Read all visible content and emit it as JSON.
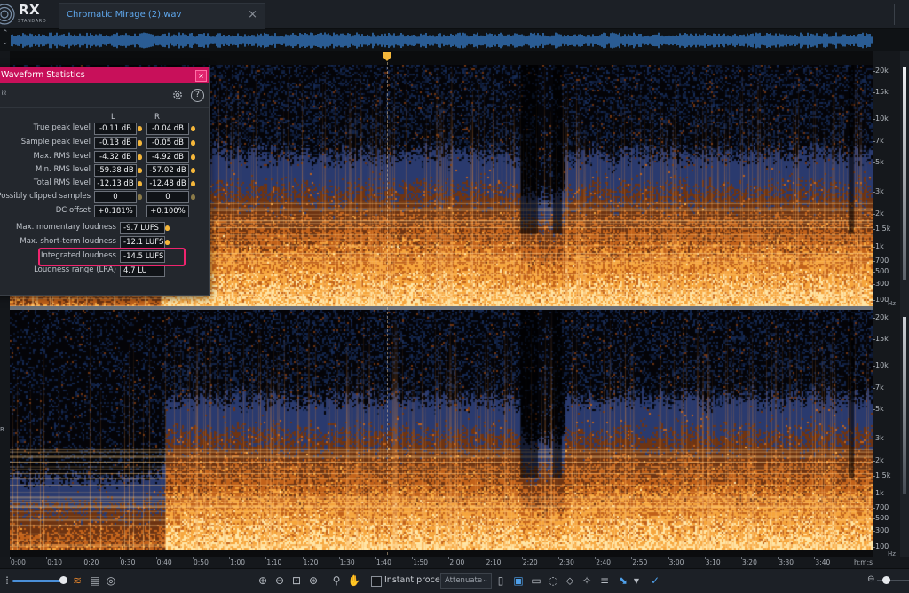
{
  "app": {
    "logo_text": "RX",
    "logo_subtext": "STANDARD",
    "tab_title": "Chromatic Mirage (2).wav",
    "tab_close": "×"
  },
  "colors": {
    "accent_pink": "#c8105a",
    "highlight_pink": "#f0246e",
    "link_blue": "#5fa8ee",
    "pin_gold": "#f4b63a",
    "spectro_hot": "#ffd27a",
    "spectro_mid": "#e07a1c",
    "spectro_cold": "#1b3f78"
  },
  "stats_panel": {
    "title": "Waveform Statistics",
    "close": "×",
    "help": "?",
    "col_left": "L",
    "col_right": "R",
    "rows": [
      {
        "label": "True peak level",
        "l": "-0.11 dB",
        "r": "-0.04 dB"
      },
      {
        "label": "Sample peak level",
        "l": "-0.13 dB",
        "r": "-0.05 dB"
      },
      {
        "label": "Max. RMS level",
        "l": "-4.32 dB",
        "r": "-4.92 dB"
      },
      {
        "label": "Min. RMS level",
        "l": "-59.38 dB",
        "r": "-57.02 dB"
      },
      {
        "label": "Total RMS level",
        "l": "-12.13 dB",
        "r": "-12.48 dB"
      },
      {
        "label": "Possibly clipped samples",
        "l": "0",
        "r": "0"
      },
      {
        "label": "DC offset",
        "l": "+0.181%",
        "r": "+0.100%"
      }
    ],
    "loudness": [
      {
        "label": "Max. momentary loudness",
        "value": "-9.7 LUFS"
      },
      {
        "label": "Max. short-term loudness",
        "value": "-12.1 LUFS"
      },
      {
        "label": "Integrated loudness",
        "value": "-14.5 LUFS"
      },
      {
        "label": "Loudness range (LRA)",
        "value": "4.7 LU"
      }
    ]
  },
  "freq_scale": {
    "labels": [
      "20k",
      "15k",
      "10k",
      "7k",
      "5k",
      "3k",
      "2k",
      "1.5k",
      "1k",
      "700",
      "500",
      "300",
      "100"
    ],
    "unit": "Hz"
  },
  "channel_marker": "R",
  "time_ruler": {
    "labels": [
      "0:00",
      "0:10",
      "0:20",
      "0:30",
      "0:40",
      "0:50",
      "1:00",
      "1:10",
      "1:20",
      "1:30",
      "1:40",
      "1:50",
      "2:00",
      "2:10",
      "2:20",
      "2:30",
      "2:40",
      "2:50",
      "3:00",
      "3:10",
      "3:20",
      "3:30",
      "3:40"
    ],
    "units": "h:m:s"
  },
  "bottom_toolbar": {
    "instant_process_label": "Instant process",
    "instant_process_checked": false,
    "attenuate_label": "Attenuate",
    "icons": [
      "waveform-spectrogram-toggle",
      "markers-list-icon",
      "snapshot-icon",
      "zoom-in-icon",
      "zoom-out-icon",
      "zoom-selection-icon",
      "zoom-fit-icon",
      "magnify-icon",
      "hand-icon",
      "time-selection-icon",
      "frequency-selection-icon",
      "lasso-icon",
      "brush-icon",
      "magic-wand-icon",
      "harmonic-selection-icon",
      "deselect-icon",
      "smart-select-icon"
    ]
  }
}
